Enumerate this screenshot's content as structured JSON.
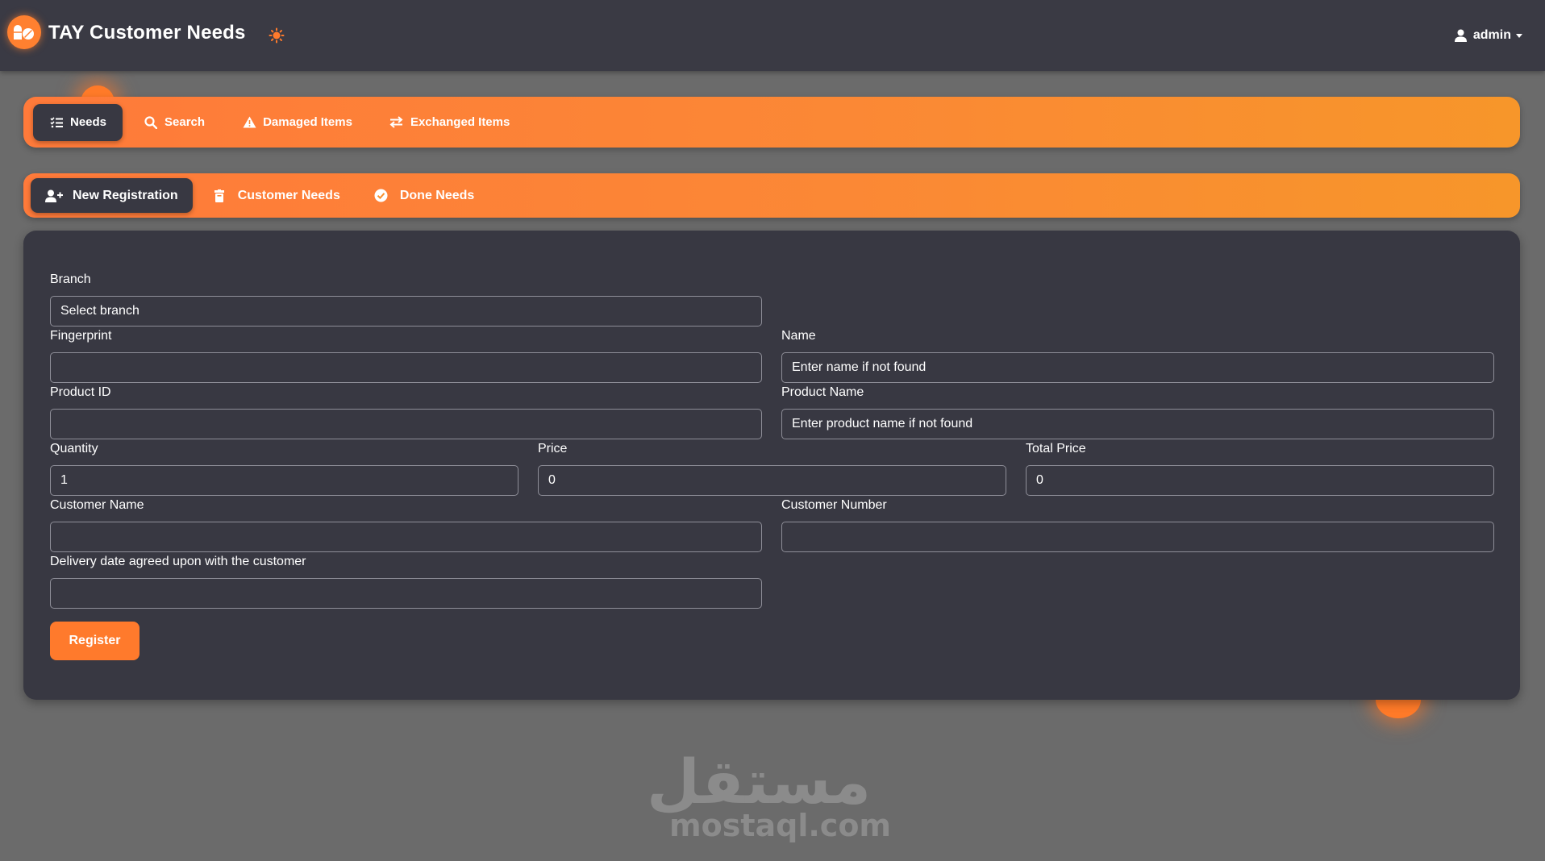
{
  "app": {
    "title": "TAY Customer Needs",
    "user": "admin"
  },
  "colors": {
    "accent": "#ff7a2c",
    "panel": "#383842",
    "topbar": "#3a3a44",
    "background": "#6b6b6b"
  },
  "main_nav": [
    {
      "label": "Needs",
      "icon": "list-check-icon",
      "active": true
    },
    {
      "label": "Search",
      "icon": "search-icon",
      "active": false
    },
    {
      "label": "Damaged Items",
      "icon": "warning-triangle-icon",
      "active": false
    },
    {
      "label": "Exchanged Items",
      "icon": "exchange-arrows-icon",
      "active": false
    }
  ],
  "sub_nav": [
    {
      "label": "New Registration",
      "icon": "user-plus-icon",
      "active": true
    },
    {
      "label": "Customer Needs",
      "icon": "trash-box-icon",
      "active": false
    },
    {
      "label": "Done Needs",
      "icon": "check-circle-icon",
      "active": false
    }
  ],
  "form": {
    "branch": {
      "label": "Branch",
      "value": "",
      "placeholder": "Select branch"
    },
    "fingerprint": {
      "label": "Fingerprint",
      "value": "",
      "placeholder": ""
    },
    "name": {
      "label": "Name",
      "value": "",
      "placeholder": "Enter name if not found"
    },
    "product_id": {
      "label": "Product ID",
      "value": "",
      "placeholder": ""
    },
    "product_name": {
      "label": "Product Name",
      "value": "",
      "placeholder": "Enter product name if not found"
    },
    "quantity": {
      "label": "Quantity",
      "value": "1"
    },
    "price": {
      "label": "Price",
      "value": "0"
    },
    "total_price": {
      "label": "Total Price",
      "value": "0"
    },
    "customer_name": {
      "label": "Customer Name",
      "value": ""
    },
    "customer_number": {
      "label": "Customer Number",
      "value": ""
    },
    "delivery_date": {
      "label": "Delivery date agreed upon with the customer",
      "value": ""
    },
    "submit_label": "Register"
  },
  "watermark": {
    "arabic": "مستقل",
    "latin": "mostaql.com"
  }
}
